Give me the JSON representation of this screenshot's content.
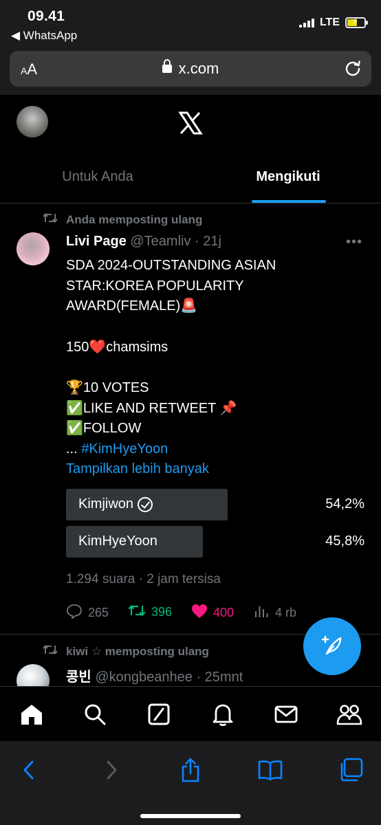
{
  "status_bar": {
    "time": "09.41",
    "back_app": "◀ WhatsApp",
    "network": "LTE",
    "battery_level": 0.6,
    "battery_charging": true
  },
  "browser": {
    "text_size_button": "AA",
    "url": "x.com",
    "reload_icon": "reload-icon"
  },
  "header": {
    "logo": "𝕏"
  },
  "tabs": [
    {
      "label": "Untuk Anda",
      "active": false
    },
    {
      "label": "Mengikuti",
      "active": true
    }
  ],
  "tweet": {
    "retweeted_by": "Anda memposting ulang",
    "author_name": "Livi Page",
    "author_meta": " @Teamliv · 21j",
    "lines": [
      "SDA 2024-OUTSTANDING ASIAN",
      "STAR:KOREA POPULARITY",
      "AWARD(FEMALE)🚨",
      "",
      "150❤️chamsims",
      "",
      "🏆10 VOTES",
      "✅LIKE AND RETWEET 📌",
      "✅FOLLOW"
    ],
    "hashtag_prefix": "... ",
    "hashtag": "#KimHyeYoon",
    "show_more": "Tampilkan lebih banyak",
    "poll": {
      "options": [
        {
          "label": "Kimjiwon",
          "percent_text": "54,2%",
          "fraction": 0.542,
          "voted": true
        },
        {
          "label": "KimHyeYoon",
          "percent_text": "45,8%",
          "fraction": 0.458,
          "voted": false
        }
      ],
      "meta": "1.294 suara · 2 jam tersisa"
    },
    "actions": {
      "replies": "265",
      "retweets": "396",
      "likes": "400",
      "views": "4 rb"
    }
  },
  "tweet2": {
    "retweeted_by": "kiwi ☆ memposting ulang",
    "author_name": "콩빈",
    "author_meta": " @kongbeanhee · 25mnt"
  },
  "colors": {
    "accent": "#1d9bf0",
    "retweet": "#00ba7c",
    "like": "#f91880",
    "muted": "#71767b"
  }
}
